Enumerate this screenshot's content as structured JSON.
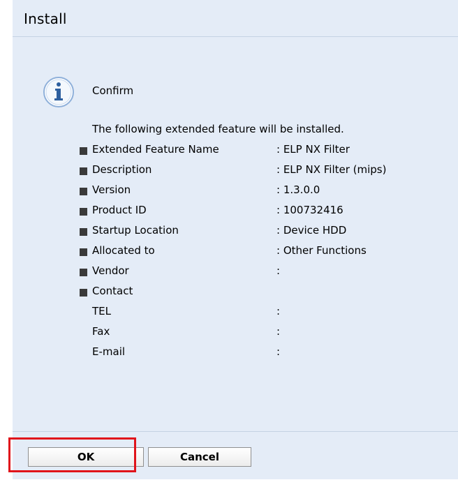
{
  "dialog": {
    "title": "Install",
    "confirm_label": "Confirm",
    "intro": "The following extended feature will be installed.",
    "rows": [
      {
        "label": "Extended Feature Name",
        "value": ": ELP NX Filter"
      },
      {
        "label": "Description",
        "value": ": ELP NX Filter (mips)"
      },
      {
        "label": "Version",
        "value": ": 1.3.0.0"
      },
      {
        "label": "Product ID",
        "value": ": 100732416"
      },
      {
        "label": "Startup Location",
        "value": ": Device HDD"
      },
      {
        "label": "Allocated to",
        "value": ": Other Functions"
      },
      {
        "label": "Vendor",
        "value": ":"
      },
      {
        "label": "Contact",
        "value": ""
      },
      {
        "label": "TEL",
        "value": ":"
      },
      {
        "label": "Fax",
        "value": ":"
      },
      {
        "label": "E-mail",
        "value": ":"
      }
    ]
  },
  "buttons": {
    "ok_label": "OK",
    "cancel_label": "Cancel"
  },
  "icons": {
    "info": "info-icon"
  },
  "colors": {
    "panel_bg": "#e4ecf7",
    "highlight": "#e0141b",
    "info_icon": "#3b6fb6"
  }
}
